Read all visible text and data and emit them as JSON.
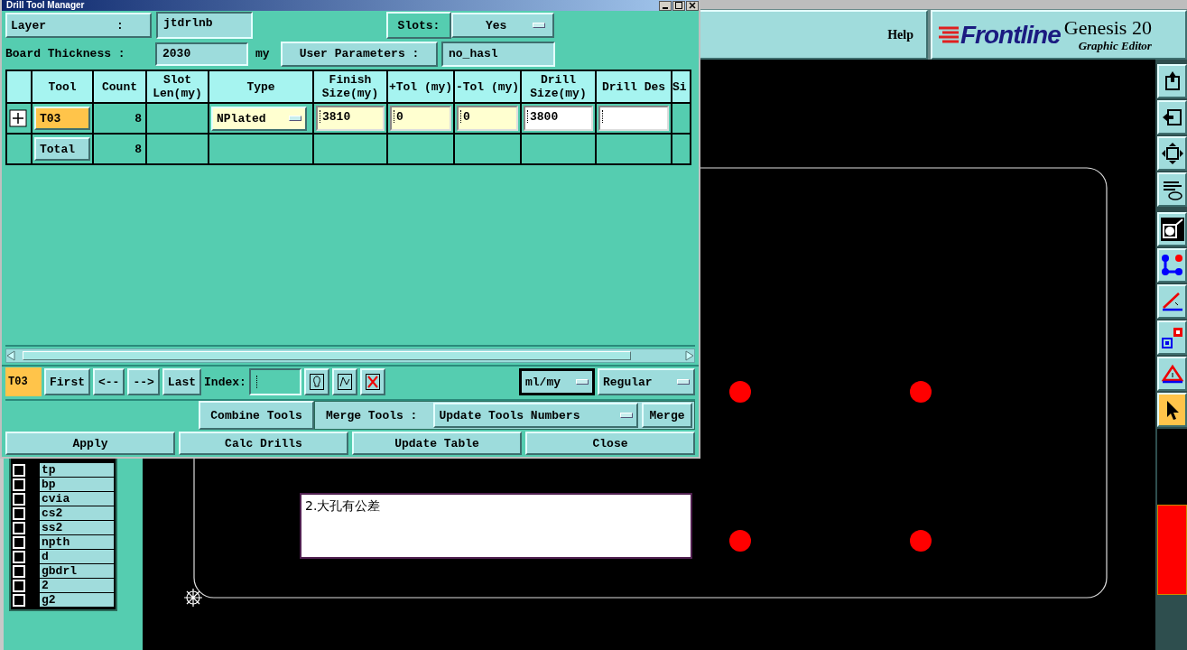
{
  "app": {
    "help": "Help",
    "logo": {
      "brand": "Frontline",
      "product": "Genesis 20",
      "subtitle": "Graphic Editor"
    }
  },
  "toolbar": [
    {
      "kind": "export",
      "selected": false
    },
    {
      "kind": "import",
      "selected": false
    },
    {
      "kind": "resize",
      "selected": false
    },
    {
      "kind": "tools",
      "selected": false
    },
    {
      "kind": "circle",
      "selected": false
    },
    {
      "kind": "nodes",
      "selected": false
    },
    {
      "kind": "angle",
      "selected": false
    },
    {
      "kind": "squares",
      "selected": false
    },
    {
      "kind": "triangle",
      "selected": false
    },
    {
      "kind": "pointer",
      "selected": true
    }
  ],
  "layers": [
    {
      "name": "tp",
      "checked": false
    },
    {
      "name": "bp",
      "checked": false
    },
    {
      "name": "cvia",
      "checked": false
    },
    {
      "name": "cs2",
      "checked": false
    },
    {
      "name": "ss2",
      "checked": false
    },
    {
      "name": "npth",
      "checked": false
    },
    {
      "name": "d",
      "checked": false
    },
    {
      "name": "gbdrl",
      "checked": false
    },
    {
      "name": "2",
      "checked": false
    },
    {
      "name": "g2",
      "checked": false
    }
  ],
  "canvas": {
    "note": "2.大孔有公差"
  },
  "dialog": {
    "title": "Drill Tool Manager",
    "layer_label": "Layer          :",
    "layer_value": "jtdrlnb",
    "slots_label": "Slots:",
    "slots_value": "Yes",
    "thickness_label": "Board Thickness :",
    "thickness_value": "2030",
    "thickness_unit": "my",
    "user_params_label": "User Parameters :",
    "user_params_value": "no_hasl",
    "table": {
      "columns": [
        "Tool",
        "Count",
        "Slot Len(my)",
        "Type",
        "Finish Size(my)",
        "+Tol (my)",
        "-Tol (my)",
        "Drill Size(my)",
        "Drill Des",
        "Si"
      ],
      "rows": [
        {
          "kind": "tool",
          "selected": true,
          "tool": "T03",
          "count": "8",
          "type": "NPlated",
          "finish_size": "3810",
          "plus_tol": "0",
          "minus_tol": "0",
          "drill_size": "3800"
        },
        {
          "kind": "total",
          "selected": false,
          "tool": "Total",
          "count": "8"
        }
      ]
    },
    "nav": {
      "current_tool": "T03",
      "buttons": [
        "First",
        "<--",
        "-->",
        "Last"
      ],
      "index_label": "Index:",
      "units": "ml/my",
      "mode": "Regular"
    },
    "merge": {
      "combine": "Combine Tools",
      "label": "Merge Tools :",
      "option": "Update Tools Numbers",
      "button": "Merge"
    },
    "buttons": [
      "Apply",
      "Calc Drills",
      "Update Table",
      "Close"
    ]
  }
}
